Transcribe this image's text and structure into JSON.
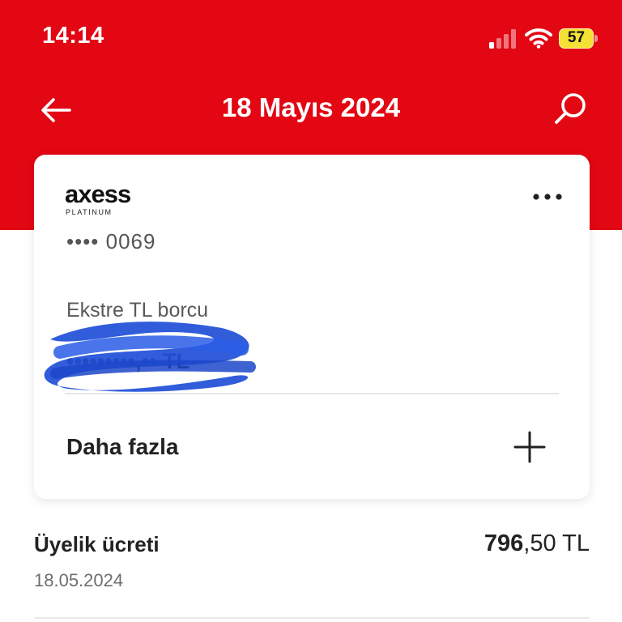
{
  "status_bar": {
    "time": "14:14",
    "battery_level": "57",
    "battery_color": "#f5e135"
  },
  "colors": {
    "brand_red": "#e30613",
    "redaction_blue": "#1f4fd8"
  },
  "nav": {
    "title": "18 Mayıs 2024",
    "back_icon": "arrow-left-icon",
    "search_icon": "search-icon"
  },
  "card": {
    "brand_name": "axess",
    "brand_tier": "PLATINUM",
    "card_number_masked": "•••• 0069",
    "more_icon": "more-horizontal-icon",
    "debt_label": "Ekstre TL borcu",
    "debt_amount": "•••••••••,•• TL",
    "more_label": "Daha fazla",
    "expand_icon": "plus-icon"
  },
  "transaction": {
    "title": "Üyelik ücreti",
    "amount_integer": "796",
    "amount_rest": ",50 TL",
    "date": "18.05.2024"
  }
}
